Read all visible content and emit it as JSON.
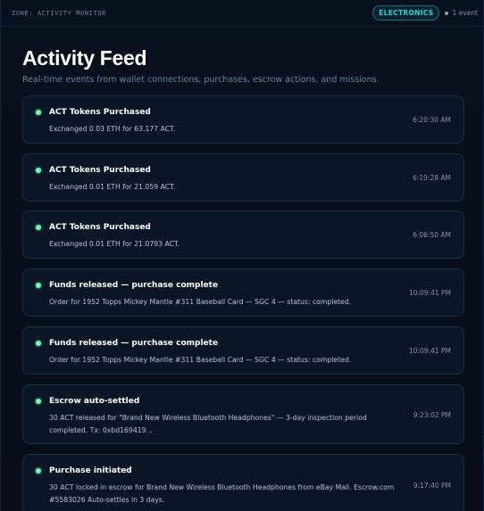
{
  "header": {
    "zone_label": "ZONE: ACTIVITY MONITOR",
    "category_badge": "ELECTRONICS",
    "event_count": "1 event"
  },
  "page": {
    "title": "Activity Feed",
    "subtitle": "Real-time events from wallet connections, purchases, escrow actions, and missions."
  },
  "events": [
    {
      "title": "ACT Tokens Purchased",
      "description": "Exchanged 0.03 ETH for 63.177 ACT.",
      "time": "6:20:30 AM"
    },
    {
      "title": "ACT Tokens Purchased",
      "description": "Exchanged 0.01 ETH for 21.059 ACT.",
      "time": "6:19:28 AM"
    },
    {
      "title": "ACT Tokens Purchased",
      "description": "Exchanged 0.01 ETH for 21.0793 ACT.",
      "time": "6:06:50 AM"
    },
    {
      "title": "Funds released — purchase complete",
      "description": "Order for 1952 Topps Mickey Mantle #311 Baseball Card — SGC 4 — status: completed.",
      "time": "10:09:41 PM"
    },
    {
      "title": "Funds released — purchase complete",
      "description": "Order for 1952 Topps Mickey Mantle #311 Baseball Card — SGC 4 — status: completed.",
      "time": "10:09:41 PM"
    },
    {
      "title": "Escrow auto-settled",
      "description": "30 ACT released for \"Brand New Wireless Bluetooth Headphones\" — 3-day inspection period completed. Tx: 0xbd169419...",
      "time": "9:23:02 PM"
    },
    {
      "title": "Purchase initiated",
      "description": "30 ACT locked in escrow for Brand New Wireless Bluetooth Headphones from eBay Mall. Escrow.com #5583026 Auto-settles in 3 days.",
      "time": "9:17:40 PM"
    }
  ],
  "colors": {
    "background": "#050b16",
    "card_background": "#0a1626",
    "card_border": "#1a3146",
    "status_dot": "#7ff0b5",
    "badge_accent": "#2bd3d8"
  },
  "icons": {
    "status": "status-dot-icon",
    "count": "dot-icon"
  }
}
